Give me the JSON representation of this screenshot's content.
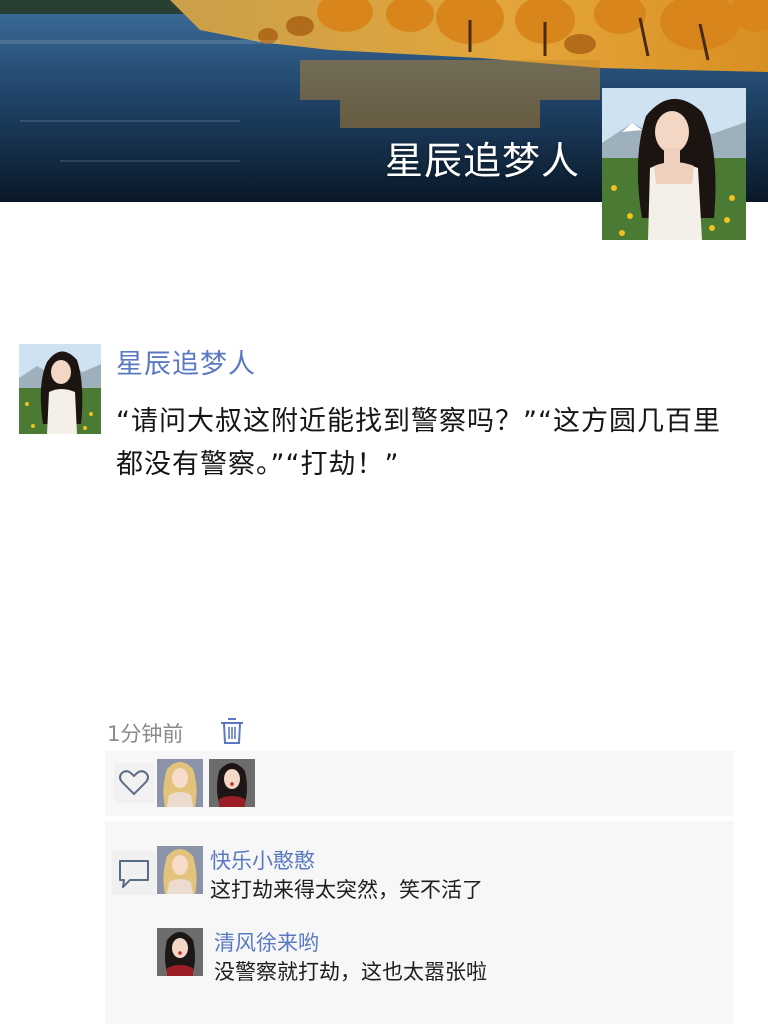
{
  "cover": {
    "username": "星辰追梦人"
  },
  "post": {
    "author": "星辰追梦人",
    "text": "“请问大叔这附近能找到警察吗？”“这方圆几百里都没有警察。”“打劫！”",
    "time": "1分钟前"
  },
  "likes": {
    "users": [
      "blonde-girl-avatar",
      "dark-hair-girl-avatar"
    ]
  },
  "comments": [
    {
      "name": "快乐小憨憨",
      "text": "这打劫来得太突然，笑不活了"
    },
    {
      "name": "清风徐来哟",
      "text": "没警察就打劫，这也太嚣张啦"
    }
  ],
  "icons": {
    "delete": "trash-icon",
    "like": "heart-icon",
    "comment": "comment-bubble-icon"
  },
  "colors": {
    "link": "#5b79c2",
    "panel": "#f7f7f7",
    "meta": "#8a8a8a"
  }
}
